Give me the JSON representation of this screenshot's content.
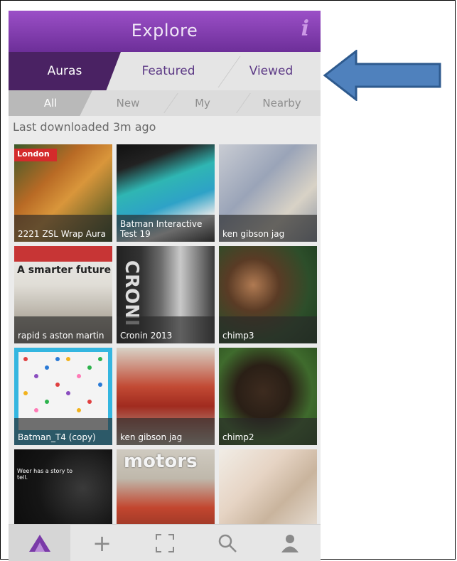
{
  "header": {
    "title": "Explore",
    "info_glyph": "i"
  },
  "tabs": [
    {
      "label": "Auras",
      "active": true
    },
    {
      "label": "Featured",
      "active": false
    },
    {
      "label": "Viewed",
      "active": false
    }
  ],
  "subtabs": [
    {
      "label": "All",
      "active": true
    },
    {
      "label": "New",
      "active": false
    },
    {
      "label": "My",
      "active": false
    },
    {
      "label": "Nearby",
      "active": false
    }
  ],
  "status_text": "Last downloaded 3m ago",
  "grid": {
    "tiles": [
      {
        "caption": "2221 ZSL Wrap Aura",
        "badge": "London"
      },
      {
        "caption": "Batman Interactive Test 19"
      },
      {
        "caption": "ken gibson jag"
      },
      {
        "caption": "rapid s aston martin",
        "headline": "A smarter future"
      },
      {
        "caption": "Cronin 2013",
        "headline": "CRONI"
      },
      {
        "caption": "chimp3"
      },
      {
        "caption": "Batman_T4 (copy)"
      },
      {
        "caption": "ken gibson jag"
      },
      {
        "caption": "chimp2"
      },
      {
        "caption": "",
        "headline": "Weer has a story to tell."
      },
      {
        "caption": "",
        "headline": "motors"
      },
      {
        "caption": ""
      }
    ]
  },
  "bottom_nav": [
    {
      "icon": "aura-logo-icon",
      "active": true
    },
    {
      "icon": "plus-icon",
      "glyph": "+"
    },
    {
      "icon": "scan-frame-icon",
      "glyph": "⛶"
    },
    {
      "icon": "search-icon"
    },
    {
      "icon": "profile-icon"
    }
  ],
  "colors": {
    "header_purple": "#7a3aa8",
    "active_tab": "#4a2263",
    "arrow_blue": "#4f81bd"
  }
}
